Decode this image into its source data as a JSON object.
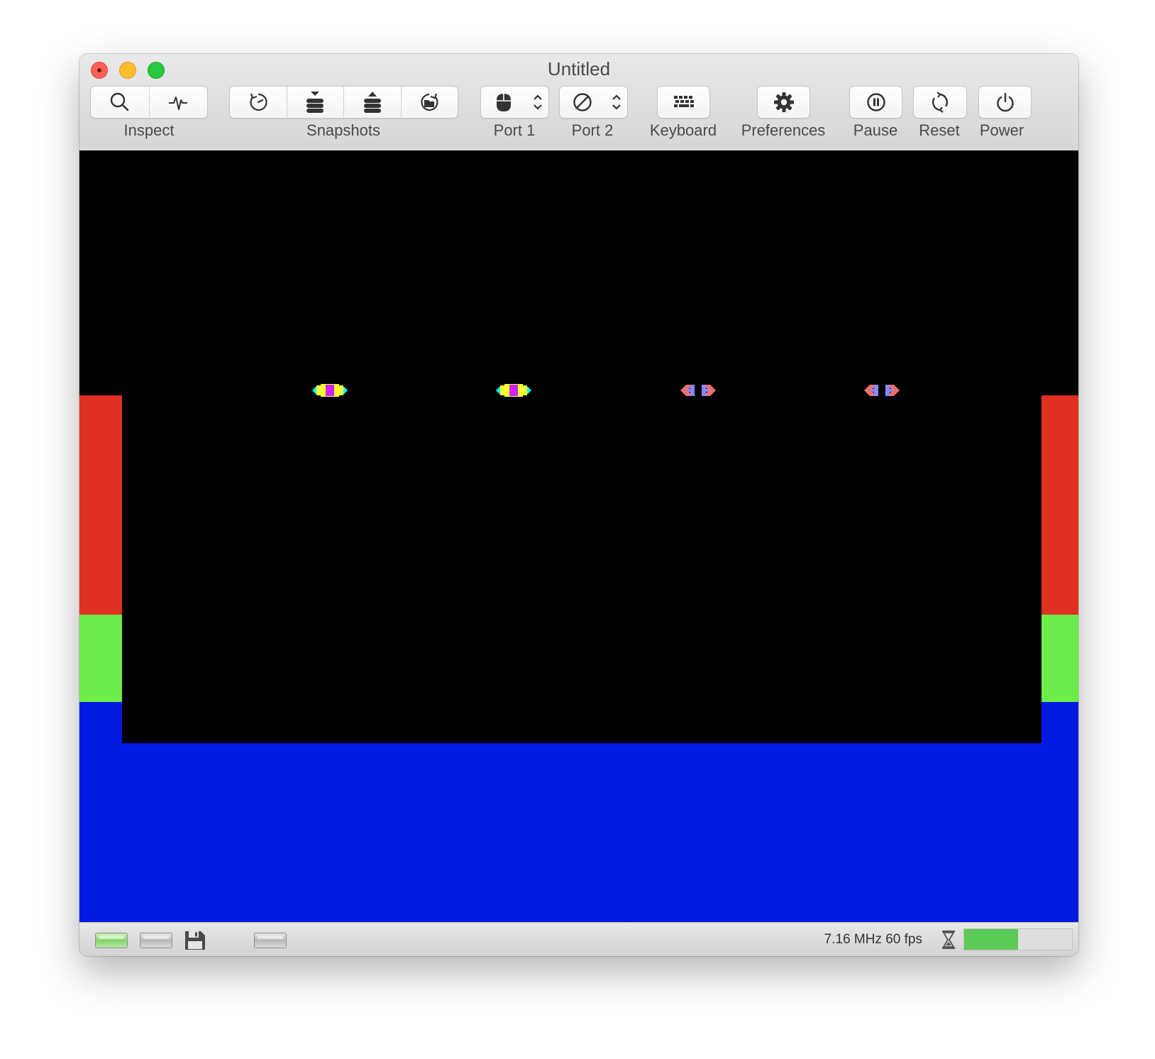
{
  "window": {
    "title": "Untitled"
  },
  "toolbar": {
    "inspect_label": "Inspect",
    "snapshots_label": "Snapshots",
    "port1_label": "Port 1",
    "port2_label": "Port 2",
    "keyboard_label": "Keyboard",
    "preferences_label": "Preferences",
    "pause_label": "Pause",
    "reset_label": "Reset",
    "power_label": "Power",
    "icons": {
      "inspect": [
        "search-icon",
        "waveform-icon"
      ],
      "snapshots": [
        "rewind-icon",
        "take-snapshot-icon",
        "restore-snapshot-icon",
        "browse-snapshots-icon"
      ],
      "port1": "mouse-icon",
      "port2": "no-device-icon",
      "keyboard": "keyboard-icon",
      "preferences": "gear-icon",
      "pause": "pause-icon",
      "reset": "reset-icon",
      "power": "power-icon"
    }
  },
  "screen": {
    "colors": {
      "background": "#0019e3",
      "playfield": "#000000",
      "red_bar": "#e03022",
      "green_bar": "#6ded4a"
    },
    "sprites": [
      {
        "type": "bright-saucer",
        "colors": [
          "#00ffff",
          "#ffff33",
          "#cc22ff"
        ]
      },
      {
        "type": "bright-saucer",
        "colors": [
          "#00ffff",
          "#ffff33",
          "#cc22ff"
        ]
      },
      {
        "type": "dim-saucer",
        "colors": [
          "#e87070",
          "#8a86ff"
        ]
      },
      {
        "type": "dim-saucer",
        "colors": [
          "#e87070",
          "#8a86ff"
        ]
      }
    ]
  },
  "status": {
    "speed": "7.16 MHz 60 fps",
    "indicators": [
      "drive-led-active",
      "drive-led-idle",
      "floppy-disk-icon",
      "drive-led-idle"
    ],
    "progress": 0.5
  }
}
